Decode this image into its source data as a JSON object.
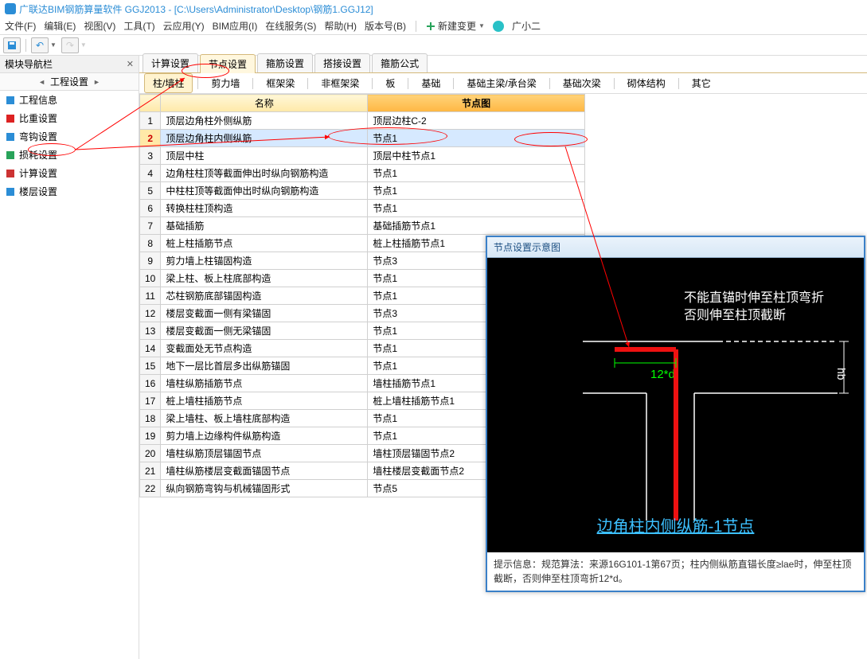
{
  "title": "广联达BIM钢筋算量软件 GGJ2013 - [C:\\Users\\Administrator\\Desktop\\钢筋1.GGJ12]",
  "menu": [
    "文件(F)",
    "编辑(E)",
    "视图(V)",
    "工具(T)",
    "云应用(Y)",
    "BIM应用(I)",
    "在线服务(S)",
    "帮助(H)",
    "版本号(B)"
  ],
  "newchange": "新建变更",
  "user": "广小二",
  "nav_header": "模块导航栏",
  "nav_sub": "工程设置",
  "nav_items": [
    {
      "label": "工程信息",
      "color": "#2b8dd6"
    },
    {
      "label": "比重设置",
      "color": "#d22"
    },
    {
      "label": "弯钩设置",
      "color": "#2b8dd6"
    },
    {
      "label": "损耗设置",
      "color": "#28a35a"
    },
    {
      "label": "计算设置",
      "color": "#c33"
    },
    {
      "label": "楼层设置",
      "color": "#2b8dd6"
    }
  ],
  "sel_nav": 4,
  "tabs1": [
    "计算设置",
    "节点设置",
    "箍筋设置",
    "搭接设置",
    "箍筋公式"
  ],
  "sel_tab1": 1,
  "tabs2": [
    "柱/墙柱",
    "剪力墙",
    "框架梁",
    "非框架梁",
    "板",
    "基础",
    "基础主梁/承台梁",
    "基础次梁",
    "砌体结构",
    "其它"
  ],
  "sel_tab2": 0,
  "cols": [
    "",
    "名称",
    "节点图"
  ],
  "rows": [
    {
      "n": "1",
      "name": "顶层边角柱外侧纵筋",
      "val": "顶层边柱C-2"
    },
    {
      "n": "2",
      "name": "顶层边角柱内侧纵筋",
      "val": "节点1"
    },
    {
      "n": "3",
      "name": "顶层中柱",
      "val": "顶层中柱节点1"
    },
    {
      "n": "4",
      "name": "边角柱柱顶等截面伸出时纵向钢筋构造",
      "val": "节点1"
    },
    {
      "n": "5",
      "name": "中柱柱顶等截面伸出时纵向钢筋构造",
      "val": "节点1"
    },
    {
      "n": "6",
      "name": "转换柱柱顶构造",
      "val": "节点1"
    },
    {
      "n": "7",
      "name": "基础插筋",
      "val": "基础插筋节点1"
    },
    {
      "n": "8",
      "name": "桩上柱插筋节点",
      "val": "桩上柱插筋节点1"
    },
    {
      "n": "9",
      "name": "剪力墙上柱锚固构造",
      "val": "节点3"
    },
    {
      "n": "10",
      "name": "梁上柱、板上柱底部构造",
      "val": "节点1"
    },
    {
      "n": "11",
      "name": "芯柱钢筋底部锚固构造",
      "val": "节点1"
    },
    {
      "n": "12",
      "name": "楼层变截面一侧有梁锚固",
      "val": "节点3"
    },
    {
      "n": "13",
      "name": "楼层变截面一侧无梁锚固",
      "val": "节点1"
    },
    {
      "n": "14",
      "name": "变截面处无节点构造",
      "val": "节点1"
    },
    {
      "n": "15",
      "name": "地下一层比首层多出纵筋锚固",
      "val": "节点1"
    },
    {
      "n": "16",
      "name": "墙柱纵筋插筋节点",
      "val": "墙柱插筋节点1"
    },
    {
      "n": "17",
      "name": "桩上墙柱插筋节点",
      "val": "桩上墙柱插筋节点1"
    },
    {
      "n": "18",
      "name": "梁上墙柱、板上墙柱底部构造",
      "val": "节点1"
    },
    {
      "n": "19",
      "name": "剪力墙上边缘构件纵筋构造",
      "val": "节点1"
    },
    {
      "n": "20",
      "name": "墙柱纵筋顶层锚固节点",
      "val": "墙柱顶层锚固节点2"
    },
    {
      "n": "21",
      "name": "墙柱纵筋楼层变截面锚固节点",
      "val": "墙柱楼层变截面节点2"
    },
    {
      "n": "22",
      "name": "纵向钢筋弯钩与机械锚固形式",
      "val": "节点5"
    }
  ],
  "sel_row": 1,
  "popup": {
    "title": "节点设置示意图",
    "line1": "不能直锚时伸至柱顶弯折",
    "line2": "否则伸至柱顶截断",
    "dim": "12*d",
    "hb": "hb",
    "caption": "边角柱内侧纵筋-1节点",
    "foot_label": "提示信息：",
    "foot": "规范算法：来源16G101-1第67页；柱内侧纵筋直锚长度≥lae时，伸至柱顶截断，否则伸至柱顶弯折12*d。"
  }
}
